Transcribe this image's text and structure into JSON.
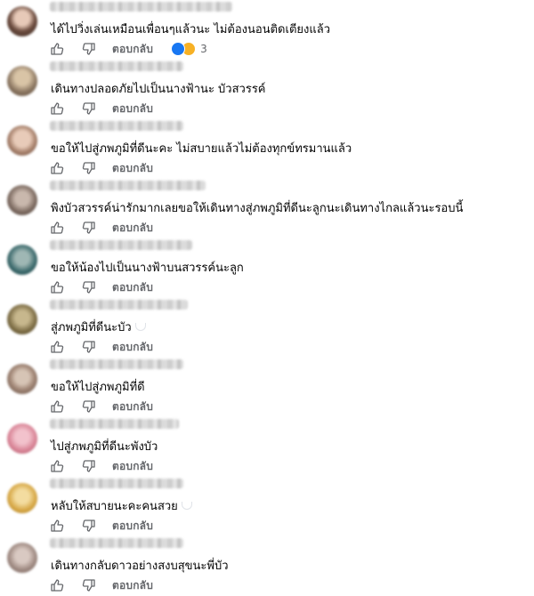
{
  "reply_label": "ตอบกลับ",
  "colors": {
    "action_text": "#65676b",
    "like_reaction": "#1877f2",
    "sad_reaction": "#f7b125"
  },
  "comments": [
    {
      "text": "ได้ไปวิ่งเล่นเหมือนเพื่อนๆแล้วนะ ไม่ต้องนอนติดเตียงแล้ว",
      "reaction_count": "3"
    },
    {
      "text": "เดินทางปลอดภัยไปเป็นนางฟ้านะ บัวสวรรค์"
    },
    {
      "text": "ขอให้ไปสู่ภพภูมิที่ดีนะคะ ไม่สบายแล้วไม่ต้องทุกข์ทรมานแล้ว"
    },
    {
      "text": "พิงบัวสวรรค์น่ารักมากเลยขอให้เดินทางสู่ภพภูมิที่ดีนะลูกนะเดินทางไกลแล้วนะรอบนี้"
    },
    {
      "text": "ขอให้น้องไปเป็นนางฟ้าบนสวรรค์นะลูก"
    },
    {
      "text": "สู่ภพภูมิที่ดีนะบัว"
    },
    {
      "text": "ขอให้ไปสู่ภพภูมิที่ดี"
    },
    {
      "text": "ไปสู่ภพภูมิที่ดีนะพังบัว"
    },
    {
      "text": "หลับให้สบายนะคะคนสวย"
    },
    {
      "text": "เดินทางกลับดาวอย่างสงบสุขนะพี่บัว"
    }
  ]
}
